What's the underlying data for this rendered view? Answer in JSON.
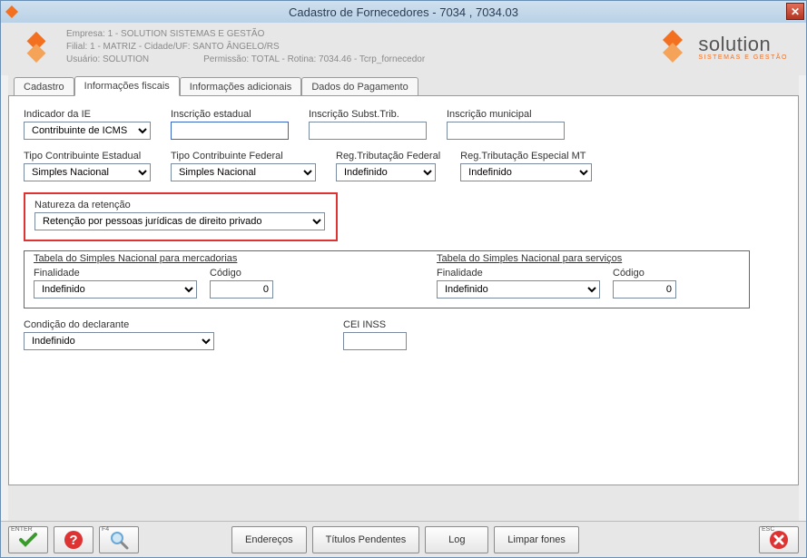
{
  "window": {
    "title": "Cadastro de Fornecedores - 7034 , 7034.03"
  },
  "header": {
    "empresa": "Empresa: 1 - SOLUTION SISTEMAS E GESTÃO",
    "filial": "Filial: 1 - MATRIZ - Cidade/UF: SANTO ÂNGELO/RS",
    "usuario": "Usuário: SOLUTION",
    "permissao": "Permissão: TOTAL - Rotina: 7034.46 - Tcrp_fornecedor",
    "brand_name": "solution",
    "brand_tag": "SISTEMAS E GESTÃO"
  },
  "tabs": {
    "t0": "Cadastro",
    "t1": "Informações fiscais",
    "t2": "Informações adicionais",
    "t3": "Dados do Pagamento"
  },
  "fields": {
    "indicador_ie_label": "Indicador da IE",
    "indicador_ie_value": "Contribuinte de ICMS",
    "inscricao_estadual_label": "Inscrição estadual",
    "inscricao_estadual_value": "",
    "inscricao_subst_label": "Inscrição Subst.Trib.",
    "inscricao_subst_value": "",
    "inscricao_municipal_label": "Inscrição municipal",
    "inscricao_municipal_value": "",
    "tipo_contrib_estadual_label": "Tipo Contribuinte Estadual",
    "tipo_contrib_estadual_value": "Simples Nacional",
    "tipo_contrib_federal_label": "Tipo Contribuinte Federal",
    "tipo_contrib_federal_value": "Simples Nacional",
    "reg_trib_federal_label": "Reg.Tributação Federal",
    "reg_trib_federal_value": "Indefinido",
    "reg_trib_mt_label": "Reg.Tributação Especial MT",
    "reg_trib_mt_value": "Indefinido",
    "natureza_retencao_label": "Natureza da retenção",
    "natureza_retencao_value": "Retenção por pessoas jurídicas de direito privado",
    "sn_merc_title": "Tabela do Simples Nacional para mercadorias",
    "sn_serv_title": "Tabela do Simples Nacional para serviços",
    "finalidade_label": "Finalidade",
    "codigo_label": "Código",
    "sn_merc_finalidade": "Indefinido",
    "sn_merc_codigo": "0",
    "sn_serv_finalidade": "Indefinido",
    "sn_serv_codigo": "0",
    "condicao_declarante_label": "Condição do declarante",
    "condicao_declarante_value": "Indefinido",
    "cei_inss_label": "CEI INSS",
    "cei_inss_value": ""
  },
  "footer": {
    "enter_lbl": "ENTER",
    "f4_lbl": "F4",
    "esc_lbl": "ESC",
    "enderecos": "Endereços",
    "titulos_pendentes": "Títulos Pendentes",
    "log": "Log",
    "limpar_fones": "Limpar fones"
  }
}
